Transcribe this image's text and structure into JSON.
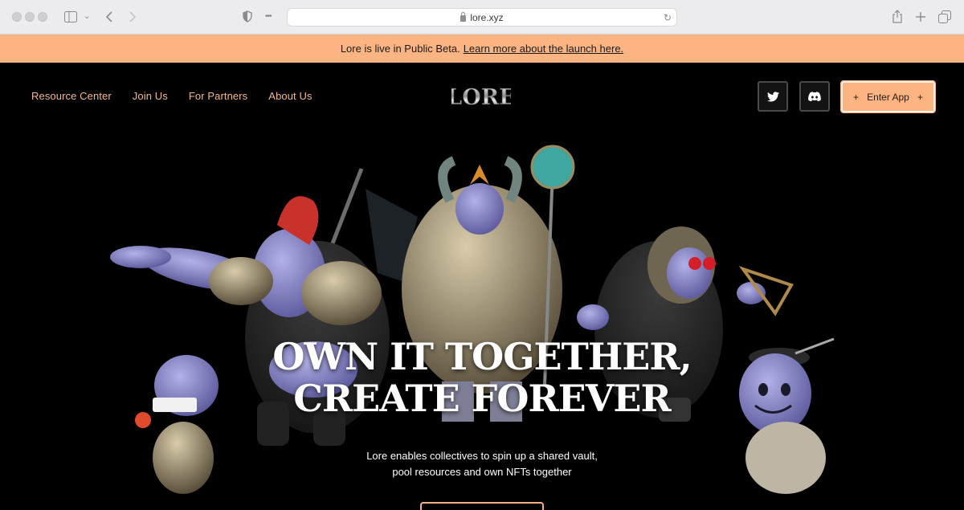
{
  "browser": {
    "url": "lore.xyz"
  },
  "banner": {
    "text": "Lore is live in Public Beta.",
    "link": "Learn more about the launch here."
  },
  "nav": {
    "items": [
      {
        "label": "Resource Center"
      },
      {
        "label": "Join Us"
      },
      {
        "label": "For Partners"
      },
      {
        "label": "About Us"
      }
    ],
    "logo_text": "LORE",
    "enter_app": "Enter App",
    "social": [
      {
        "icon": "twitter-icon"
      },
      {
        "icon": "discord-icon"
      }
    ]
  },
  "hero": {
    "headline_line1": "OWN IT TOGETHER,",
    "headline_line2": "CREATE FOREVER",
    "sub_line1": "Lore enables collectives to spin up a shared vault,",
    "sub_line2": "pool resources and own NFTs together"
  },
  "colors": {
    "accent": "#fcb582",
    "nav_text": "#f3b78c",
    "background": "#000000"
  }
}
